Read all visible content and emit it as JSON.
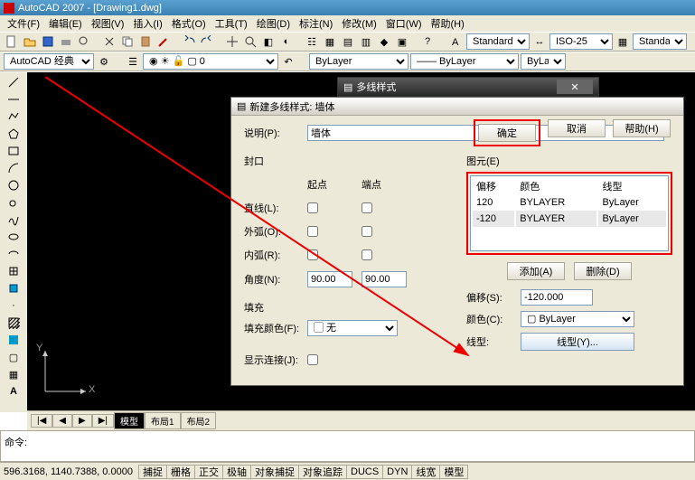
{
  "title": "AutoCAD 2007 - [Drawing1.dwg]",
  "menu": [
    "文件(F)",
    "编辑(E)",
    "视图(V)",
    "插入(I)",
    "格式(O)",
    "工具(T)",
    "绘图(D)",
    "标注(N)",
    "修改(M)",
    "窗口(W)",
    "帮助(H)"
  ],
  "toolbar3": {
    "style1": "Standard",
    "style2": "ISO-25",
    "style3": "Standard"
  },
  "workspace": "AutoCAD 经典",
  "layerprops": {
    "color": "ByLayer",
    "lw": "ByLayer",
    "lw2": "ByLa"
  },
  "inner_dialog_title": "多线样式",
  "dialog": {
    "title": "新建多线样式: 墙体",
    "desc_label": "说明(P):",
    "desc_value": "墙体",
    "caps_label": "封口",
    "caps_start": "起点",
    "caps_end": "端点",
    "caps_line": "直线(L):",
    "caps_outer": "外弧(O):",
    "caps_inner": "内弧(R):",
    "caps_angle": "角度(N):",
    "angle_start": "90.00",
    "angle_end": "90.00",
    "fill_label": "填充",
    "fillcolor_label": "填充颜色(F):",
    "fillcolor_value": "无",
    "showjoints_label": "显示连接(J):",
    "elements_label": "图元(E)",
    "cols": {
      "offset": "偏移",
      "color": "颜色",
      "lt": "线型"
    },
    "rows": [
      {
        "offset": "120",
        "color": "BYLAYER",
        "lt": "ByLayer"
      },
      {
        "offset": "-120",
        "color": "BYLAYER",
        "lt": "ByLayer"
      }
    ],
    "add_btn": "添加(A)",
    "del_btn": "删除(D)",
    "offset_label": "偏移(S):",
    "offset_value": "-120.000",
    "color_label": "颜色(C):",
    "color_value": "ByLayer",
    "lt_label": "线型:",
    "lt_btn": "线型(Y)...",
    "ok": "确定",
    "cancel": "取消",
    "help": "帮助(H)"
  },
  "cmd_prompt": "命令:",
  "status": {
    "coords": "596.3168, 1140.7388, 0.0000",
    "btns": [
      "捕捉",
      "栅格",
      "正交",
      "极轴",
      "对象捕捉",
      "对象追踪",
      "DUCS",
      "DYN",
      "线宽",
      "模型"
    ]
  },
  "tabs": {
    "nav": [
      "|◀",
      "◀",
      "▶",
      "▶|"
    ],
    "model": "模型",
    "layout1": "布局1",
    "layout2": "布局2"
  },
  "ucs": {
    "x": "X",
    "y": "Y"
  }
}
